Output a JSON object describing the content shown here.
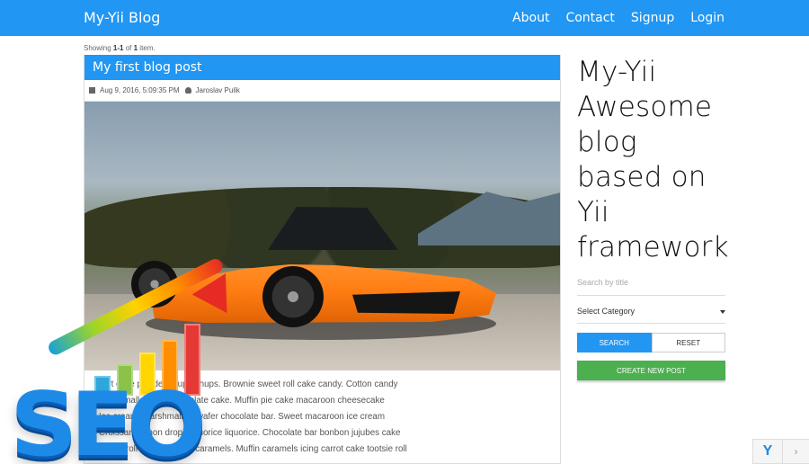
{
  "navbar": {
    "brand": "My-Yii Blog",
    "links": [
      "About",
      "Contact",
      "Signup",
      "Login"
    ]
  },
  "list": {
    "summary_prefix": "Showing ",
    "range": "1-1",
    "of": " of ",
    "total": "1",
    "suffix": " item."
  },
  "post": {
    "title": "My first blog post",
    "date": "Aug 9, 2016, 5:09:35 PM",
    "author": "Jaroslav Pulik",
    "body_lines": [
      "Tart cake powder chupa chups. Brownie sweet roll cake candy. Cotton candy",
      "marshmallow jelly chocolate cake. Muffin pie cake macaroon cheesecake",
      "Ice cream. Marshmallow wafer chocolate bar. Sweet macaroon ice cream",
      "Croissant lemon drops liquorice liquorice. Chocolate bar bonbon jujubes cake",
      "Sweet roll chocolate bar caramels. Muffin caramels icing carrot cake tootsie roll"
    ],
    "overlay_text": "SEO"
  },
  "sidebar": {
    "title": "My-Yii Awesome blog based on Yii framework",
    "search_placeholder": "Search by title",
    "category_value": "Select Category",
    "search_label": "SEARCH",
    "reset_label": "RESET",
    "create_label": "CREATE NEW POST"
  },
  "debug": {
    "logo": "Y",
    "chevron": "›"
  },
  "colors": {
    "primary": "#2196f3",
    "success": "#4caf50",
    "brand": "#1e88e5"
  }
}
